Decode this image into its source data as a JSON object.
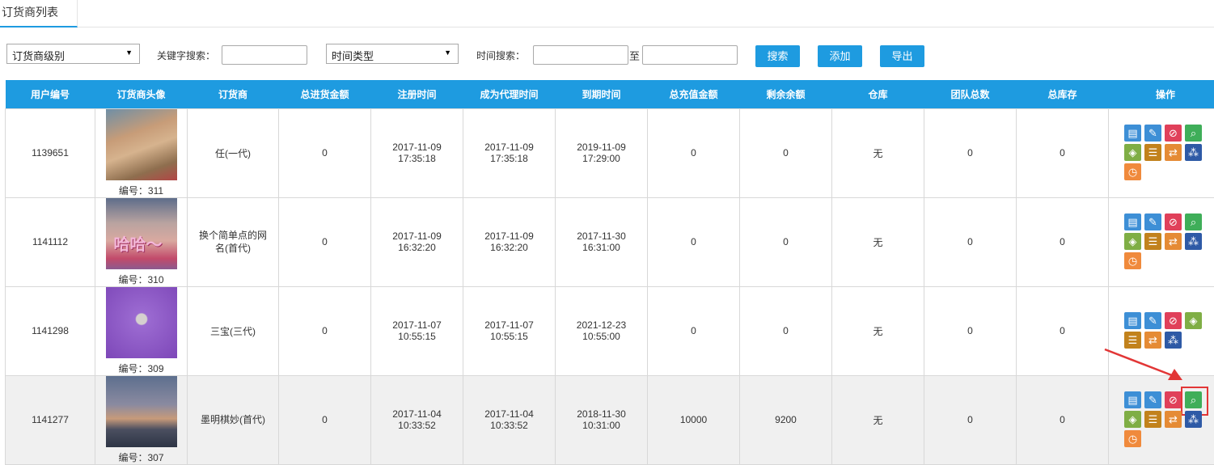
{
  "tab": {
    "title": "订货商列表"
  },
  "toolbar": {
    "level_select": "订货商级别",
    "keyword_label": "关键字搜索：",
    "keyword_value": "",
    "time_type_select": "时间类型",
    "time_search_label": "时间搜索：",
    "date_from": "",
    "to_label": "至",
    "date_to": "",
    "search_btn": "搜索",
    "add_btn": "添加",
    "export_btn": "导出"
  },
  "table": {
    "headers": [
      "用户编号",
      "订货商头像",
      "订货商",
      "总进货金额",
      "注册时间",
      "成为代理时间",
      "到期时间",
      "总充值金额",
      "剩余余额",
      "仓库",
      "团队总数",
      "总库存",
      "操作"
    ],
    "rows": [
      {
        "user_id": "1139651",
        "avatar_code": "编号：311",
        "name": "任(一代)",
        "total_purchase": "0",
        "reg_date": "2017-11-09",
        "reg_time": "17:35:18",
        "agent_date": "2017-11-09",
        "agent_time": "17:35:18",
        "expire_date": "2019-11-09",
        "expire_time": "17:29:00",
        "total_recharge": "0",
        "balance": "0",
        "warehouse": "无",
        "team_total": "0",
        "total_stock": "0"
      },
      {
        "user_id": "1141112",
        "avatar_code": "编号：310",
        "name": "换个简单点的网名(首代)",
        "avatar_text": "哈哈～",
        "total_purchase": "0",
        "reg_date": "2017-11-09",
        "reg_time": "16:32:20",
        "agent_date": "2017-11-09",
        "agent_time": "16:32:20",
        "expire_date": "2017-11-30",
        "expire_time": "16:31:00",
        "total_recharge": "0",
        "balance": "0",
        "warehouse": "无",
        "team_total": "0",
        "total_stock": "0"
      },
      {
        "user_id": "1141298",
        "avatar_code": "编号：309",
        "name": "三宝(三代)",
        "total_purchase": "0",
        "reg_date": "2017-11-07",
        "reg_time": "10:55:15",
        "agent_date": "2017-11-07",
        "agent_time": "10:55:15",
        "expire_date": "2021-12-23",
        "expire_time": "10:55:00",
        "total_recharge": "0",
        "balance": "0",
        "warehouse": "无",
        "team_total": "0",
        "total_stock": "0"
      },
      {
        "user_id": "1141277",
        "avatar_code": "编号：307",
        "name": "墨明棋妙(首代)",
        "total_purchase": "0",
        "reg_date": "2017-11-04",
        "reg_time": "10:33:52",
        "agent_date": "2017-11-04",
        "agent_time": "10:33:52",
        "expire_date": "2018-11-30",
        "expire_time": "10:31:00",
        "total_recharge": "10000",
        "balance": "9200",
        "warehouse": "无",
        "team_total": "0",
        "total_stock": "0"
      }
    ]
  },
  "icons": {
    "edit_form": "edit-form-icon",
    "pencil": "pencil-icon",
    "disable": "disable-icon",
    "search_doc": "search-document-icon",
    "tag": "tag-icon",
    "list": "list-icon",
    "transfer": "transfer-icon",
    "team": "team-icon",
    "history": "history-icon"
  },
  "colors": {
    "accent": "#1e9be0",
    "highlight_box": "#e23636"
  }
}
